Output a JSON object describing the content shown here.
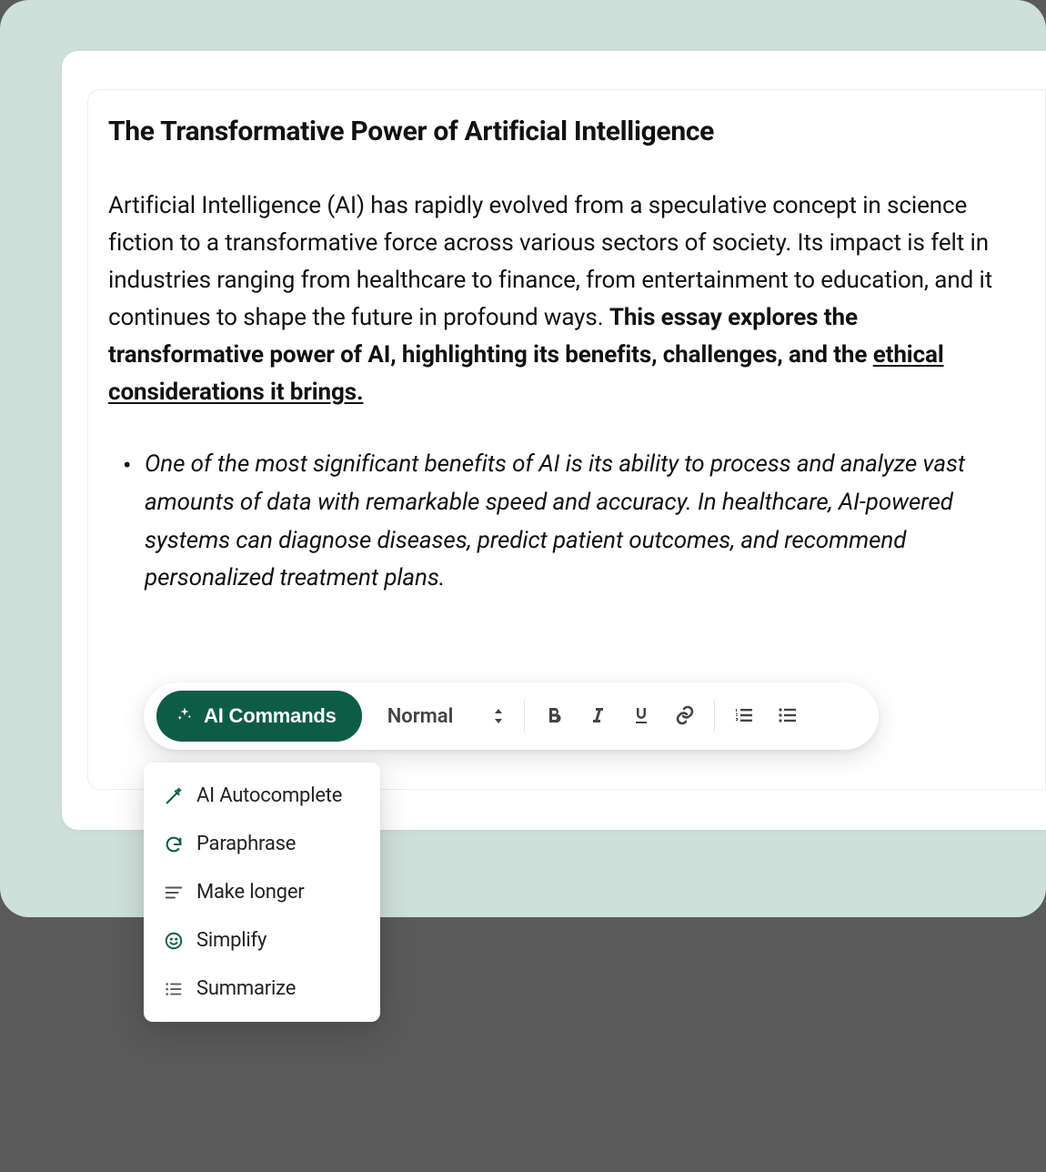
{
  "document": {
    "title": "The Transformative Power of Artificial Intelligence",
    "para_plain": "Artificial Intelligence (AI) has rapidly evolved from a speculative concept in science fiction to a transformative force across various sectors of society. Its impact is felt in industries ranging from healthcare to finance, from entertainment to education, and it continues to shape the future in profound ways. ",
    "para_bold_start": "This essay explores the transformative power of AI, highlighting its benefits, challenges, and the ",
    "para_bold_underline": "ethical considerations it brings.",
    "bullet_item": "One of the most significant benefits of AI is its ability to process and analyze vast amounts of data with remarkable speed and accuracy. In healthcare, AI-powered systems can diagnose diseases, predict patient outcomes, and recommend personalized treatment plans."
  },
  "toolbar": {
    "ai_commands_label": "AI Commands",
    "text_style_label": "Normal"
  },
  "ai_menu": {
    "items": [
      {
        "label": "AI Autocomplete",
        "icon": "wand"
      },
      {
        "label": "Paraphrase",
        "icon": "refresh"
      },
      {
        "label": "Make longer",
        "icon": "lines"
      },
      {
        "label": "Simplify",
        "icon": "smile"
      },
      {
        "label": "Summarize",
        "icon": "list"
      }
    ]
  }
}
